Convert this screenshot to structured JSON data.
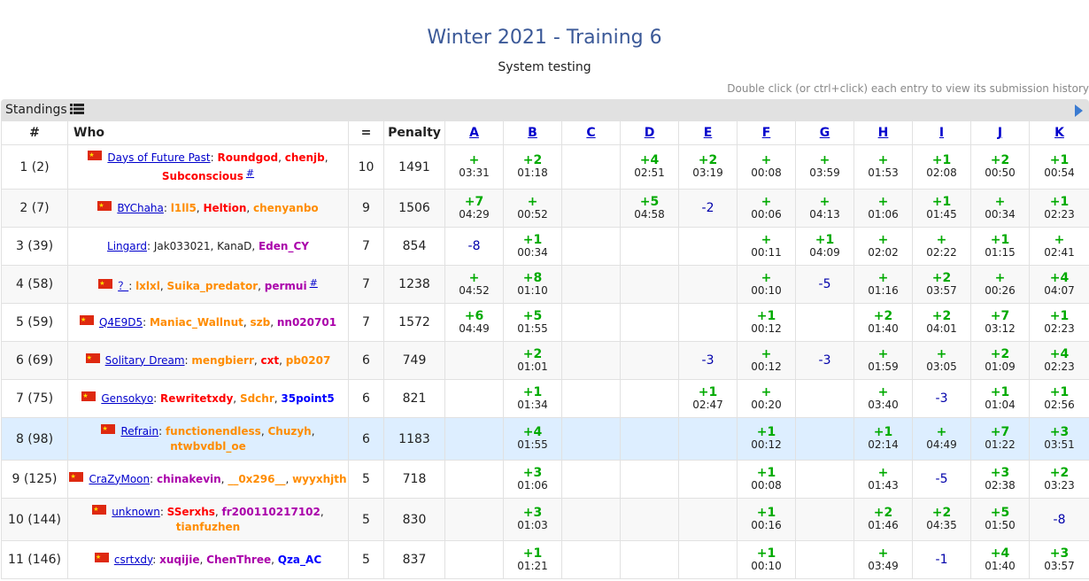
{
  "contest": {
    "title": "Winter 2021 - Training 6",
    "status": "System testing"
  },
  "hint": "Double click (or ctrl+click) each entry to view its submission history",
  "standings": {
    "label": "Standings",
    "columns": {
      "rank": "#",
      "who": "Who",
      "solved": "=",
      "penalty": "Penalty"
    },
    "problems": [
      "A",
      "B",
      "C",
      "D",
      "E",
      "F",
      "G",
      "H",
      "I",
      "J",
      "K"
    ],
    "rows": [
      {
        "rank": "1 (2)",
        "flag": true,
        "hl": false,
        "team": "Days of Future Past",
        "members": [
          {
            "name": "Roundgod",
            "c": "red"
          },
          {
            "name": "chenjb",
            "c": "red"
          },
          {
            "name": "Subconscious",
            "c": "red"
          }
        ],
        "hash": "#",
        "solved": "10",
        "penalty": "1491",
        "cells": [
          [
            "+",
            "03:31"
          ],
          [
            "+2",
            "01:18"
          ],
          null,
          [
            "+4",
            "02:51"
          ],
          [
            "+2",
            "03:19"
          ],
          [
            "+",
            "00:08"
          ],
          [
            "+",
            "03:59"
          ],
          [
            "+",
            "01:53"
          ],
          [
            "+1",
            "02:08"
          ],
          [
            "+2",
            "00:50"
          ],
          [
            "+1",
            "00:54"
          ]
        ]
      },
      {
        "rank": "2 (7)",
        "flag": true,
        "hl": false,
        "team": "BYChaha",
        "members": [
          {
            "name": "l1ll5",
            "c": "orange"
          },
          {
            "name": "Heltion",
            "c": "red"
          },
          {
            "name": "chenyanbo",
            "c": "orange"
          }
        ],
        "hash": "",
        "solved": "9",
        "penalty": "1506",
        "cells": [
          [
            "+7",
            "04:29"
          ],
          [
            "+",
            "00:52"
          ],
          null,
          [
            "+5",
            "04:58"
          ],
          [
            "-2"
          ],
          [
            "+",
            "00:06"
          ],
          [
            "+",
            "04:13"
          ],
          [
            "+",
            "01:06"
          ],
          [
            "+1",
            "01:45"
          ],
          [
            "+",
            "00:34"
          ],
          [
            "+1",
            "02:23"
          ]
        ]
      },
      {
        "rank": "3 (39)",
        "flag": false,
        "hl": false,
        "team": "Lingard",
        "members": [
          {
            "name": "Jak033021",
            "c": "black"
          },
          {
            "name": "KanaD",
            "c": "black"
          },
          {
            "name": "Eden_CY",
            "c": "violet"
          }
        ],
        "hash": "",
        "solved": "7",
        "penalty": "854",
        "cells": [
          [
            "-8"
          ],
          [
            "+1",
            "00:34"
          ],
          null,
          null,
          null,
          [
            "+",
            "00:11"
          ],
          [
            "+1",
            "04:09"
          ],
          [
            "+",
            "02:02"
          ],
          [
            "+",
            "02:22"
          ],
          [
            "+1",
            "01:15"
          ],
          [
            "+",
            "02:41"
          ]
        ]
      },
      {
        "rank": "4 (58)",
        "flag": true,
        "hl": false,
        "team": "？",
        "members": [
          {
            "name": "lxlxl",
            "c": "orange"
          },
          {
            "name": "Suika_predator",
            "c": "orange"
          },
          {
            "name": "permui",
            "c": "violet"
          }
        ],
        "hash": "#",
        "solved": "7",
        "penalty": "1238",
        "cells": [
          [
            "+",
            "04:52"
          ],
          [
            "+8",
            "01:10"
          ],
          null,
          null,
          null,
          [
            "+",
            "00:10"
          ],
          [
            "-5"
          ],
          [
            "+",
            "01:16"
          ],
          [
            "+2",
            "03:57"
          ],
          [
            "+",
            "00:26"
          ],
          [
            "+4",
            "04:07"
          ]
        ]
      },
      {
        "rank": "5 (59)",
        "flag": true,
        "hl": false,
        "team": "Q4E9D5",
        "members": [
          {
            "name": "Maniac_Wallnut",
            "c": "orange"
          },
          {
            "name": "szb",
            "c": "orange"
          },
          {
            "name": "nn020701",
            "c": "violet"
          }
        ],
        "hash": "",
        "solved": "7",
        "penalty": "1572",
        "cells": [
          [
            "+6",
            "04:49"
          ],
          [
            "+5",
            "01:55"
          ],
          null,
          null,
          null,
          [
            "+1",
            "00:12"
          ],
          null,
          [
            "+2",
            "01:40"
          ],
          [
            "+2",
            "04:01"
          ],
          [
            "+7",
            "03:12"
          ],
          [
            "+1",
            "02:23"
          ]
        ]
      },
      {
        "rank": "6 (69)",
        "flag": true,
        "hl": false,
        "team": "Solitary Dream",
        "members": [
          {
            "name": "mengbierr",
            "c": "orange"
          },
          {
            "name": "cxt",
            "c": "red"
          },
          {
            "name": "pb0207",
            "c": "orange"
          }
        ],
        "hash": "",
        "solved": "6",
        "penalty": "749",
        "cells": [
          null,
          [
            "+2",
            "01:01"
          ],
          null,
          null,
          [
            "-3"
          ],
          [
            "+",
            "00:12"
          ],
          [
            "-3"
          ],
          [
            "+",
            "01:59"
          ],
          [
            "+",
            "03:05"
          ],
          [
            "+2",
            "01:09"
          ],
          [
            "+4",
            "02:23"
          ]
        ]
      },
      {
        "rank": "7 (75)",
        "flag": true,
        "hl": false,
        "team": "Gensokyo",
        "members": [
          {
            "name": "Rewritetxdy",
            "c": "red"
          },
          {
            "name": "Sdchr",
            "c": "orange"
          },
          {
            "name": "35point5",
            "c": "blue"
          }
        ],
        "hash": "",
        "solved": "6",
        "penalty": "821",
        "cells": [
          null,
          [
            "+1",
            "01:34"
          ],
          null,
          null,
          [
            "+1",
            "02:47"
          ],
          [
            "+",
            "00:20"
          ],
          null,
          [
            "+",
            "03:40"
          ],
          [
            "-3"
          ],
          [
            "+1",
            "01:04"
          ],
          [
            "+1",
            "02:56"
          ]
        ]
      },
      {
        "rank": "8 (98)",
        "flag": true,
        "hl": true,
        "team": "Refrain",
        "members": [
          {
            "name": "functionendless",
            "c": "orange"
          },
          {
            "name": "Chuzyh",
            "c": "orange"
          },
          {
            "name": "ntwbvdbl_oe",
            "c": "orange"
          }
        ],
        "hash": "",
        "solved": "6",
        "penalty": "1183",
        "cells": [
          null,
          [
            "+4",
            "01:55"
          ],
          null,
          null,
          null,
          [
            "+1",
            "00:12"
          ],
          null,
          [
            "+1",
            "02:14"
          ],
          [
            "+",
            "04:49"
          ],
          [
            "+7",
            "01:22"
          ],
          [
            "+3",
            "03:51"
          ]
        ]
      },
      {
        "rank": "9 (125)",
        "flag": true,
        "hl": false,
        "team": "CraZyMoon",
        "members": [
          {
            "name": "chinakevin",
            "c": "violet"
          },
          {
            "name": "__0x296__",
            "c": "orange"
          },
          {
            "name": "wyyxhjth",
            "c": "orange"
          }
        ],
        "hash": "",
        "solved": "5",
        "penalty": "718",
        "cells": [
          null,
          [
            "+3",
            "01:06"
          ],
          null,
          null,
          null,
          [
            "+1",
            "00:08"
          ],
          null,
          [
            "+",
            "01:43"
          ],
          [
            "-5"
          ],
          [
            "+3",
            "02:38"
          ],
          [
            "+2",
            "03:23"
          ]
        ]
      },
      {
        "rank": "10 (144)",
        "flag": true,
        "hl": false,
        "team": "unknown",
        "members": [
          {
            "name": "SSerxhs",
            "c": "red"
          },
          {
            "name": "fr200110217102",
            "c": "violet"
          },
          {
            "name": "tianfuzhen",
            "c": "orange"
          }
        ],
        "hash": "",
        "solved": "5",
        "penalty": "830",
        "cells": [
          null,
          [
            "+3",
            "01:03"
          ],
          null,
          null,
          null,
          [
            "+1",
            "00:16"
          ],
          null,
          [
            "+2",
            "01:46"
          ],
          [
            "+2",
            "04:35"
          ],
          [
            "+5",
            "01:50"
          ],
          [
            "-8"
          ]
        ]
      },
      {
        "rank": "11 (146)",
        "flag": true,
        "hl": false,
        "team": "csrtxdy",
        "members": [
          {
            "name": "xuqijie",
            "c": "violet"
          },
          {
            "name": "ChenThree",
            "c": "violet"
          },
          {
            "name": "Qza_AC",
            "c": "blue"
          }
        ],
        "hash": "",
        "solved": "5",
        "penalty": "837",
        "cells": [
          null,
          [
            "+1",
            "01:21"
          ],
          null,
          null,
          null,
          [
            "+1",
            "00:10"
          ],
          null,
          [
            "+",
            "03:49"
          ],
          [
            "-1"
          ],
          [
            "+4",
            "01:40"
          ],
          [
            "+3",
            "03:57"
          ]
        ]
      }
    ]
  }
}
